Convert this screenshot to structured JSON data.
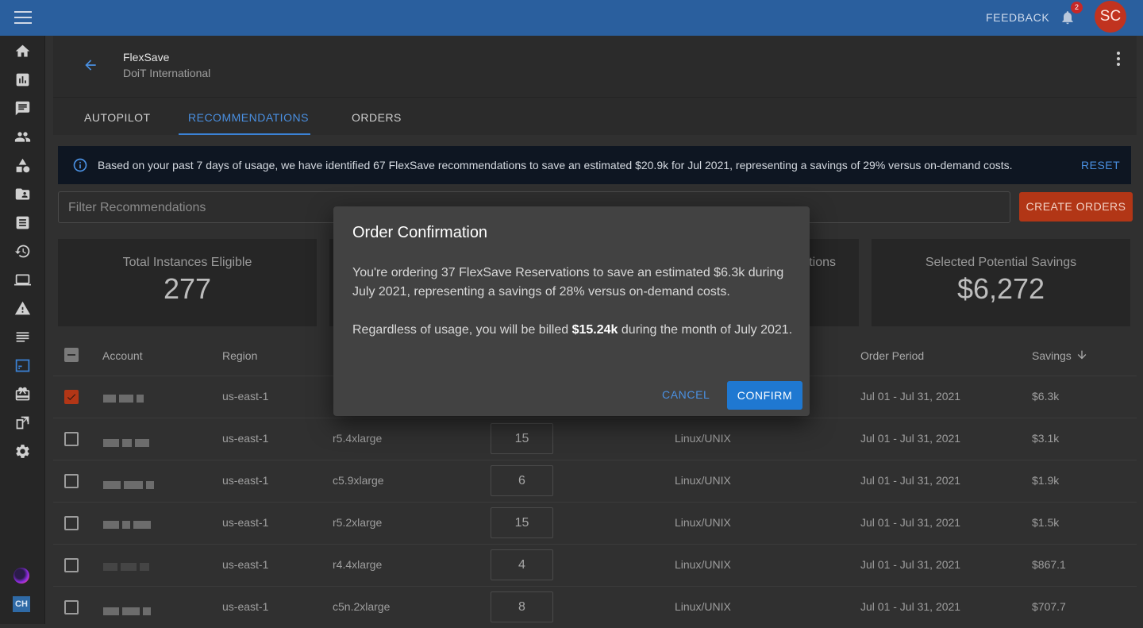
{
  "topbar": {
    "feedback": "FEEDBACK",
    "notif_count": "2",
    "avatar_initials": "SC"
  },
  "header": {
    "title": "FlexSave",
    "subtitle": "DoiT International"
  },
  "tabs": [
    {
      "label": "AUTOPILOT"
    },
    {
      "label": "RECOMMENDATIONS"
    },
    {
      "label": "ORDERS"
    }
  ],
  "banner": {
    "text": "Based on your past 7 days of usage, we have identified 67 FlexSave recommendations to save an estimated $20.9k for Jul 2021, representing a savings of 29% versus on-demand costs.",
    "reset": "RESET"
  },
  "filter": {
    "placeholder": "Filter Recommendations"
  },
  "create_orders": "CREATE ORDERS",
  "stats": [
    {
      "label": "Total Instances Eligible",
      "value": "277"
    },
    {
      "label": "tions",
      "value": ""
    },
    {
      "label": "Selected Potential Savings",
      "value": "$6,272"
    }
  ],
  "table": {
    "headers": {
      "account": "Account",
      "region": "Region",
      "order_period": "Order Period",
      "savings": "Savings"
    },
    "rows": [
      {
        "region": "us-east-1",
        "instance": "",
        "qty": "",
        "os": "",
        "period": "Jul 01 - Jul 31, 2021",
        "savings": "$6.3k",
        "checked": true
      },
      {
        "region": "us-east-1",
        "instance": "r5.4xlarge",
        "qty": "15",
        "os": "Linux/UNIX",
        "period": "Jul 01 - Jul 31, 2021",
        "savings": "$3.1k",
        "checked": false
      },
      {
        "region": "us-east-1",
        "instance": "c5.9xlarge",
        "qty": "6",
        "os": "Linux/UNIX",
        "period": "Jul 01 - Jul 31, 2021",
        "savings": "$1.9k",
        "checked": false
      },
      {
        "region": "us-east-1",
        "instance": "r5.2xlarge",
        "qty": "15",
        "os": "Linux/UNIX",
        "period": "Jul 01 - Jul 31, 2021",
        "savings": "$1.5k",
        "checked": false
      },
      {
        "region": "us-east-1",
        "instance": "r4.4xlarge",
        "qty": "4",
        "os": "Linux/UNIX",
        "period": "Jul 01 - Jul 31, 2021",
        "savings": "$867.1",
        "checked": false
      },
      {
        "region": "us-east-1",
        "instance": "c5n.2xlarge",
        "qty": "8",
        "os": "Linux/UNIX",
        "period": "Jul 01 - Jul 31, 2021",
        "savings": "$707.7",
        "checked": false
      }
    ]
  },
  "dialog": {
    "title": "Order Confirmation",
    "p1": "You're ordering 37 FlexSave Reservations to save an estimated $6.3k during July 2021, representing a savings of 28% versus on-demand costs.",
    "p2_pre": "Regardless of usage, you will be billed ",
    "p2_bold": "$15.24k",
    "p2_post": " during the month of July 2021.",
    "cancel": "CANCEL",
    "confirm": "CONFIRM"
  },
  "sidenav": {
    "bottom_badge": "CH"
  },
  "colors": {
    "topbar": "#2a5f9e",
    "accent": "#4a90e2",
    "create_orders": "#b23616",
    "confirm": "#1f78d1"
  }
}
